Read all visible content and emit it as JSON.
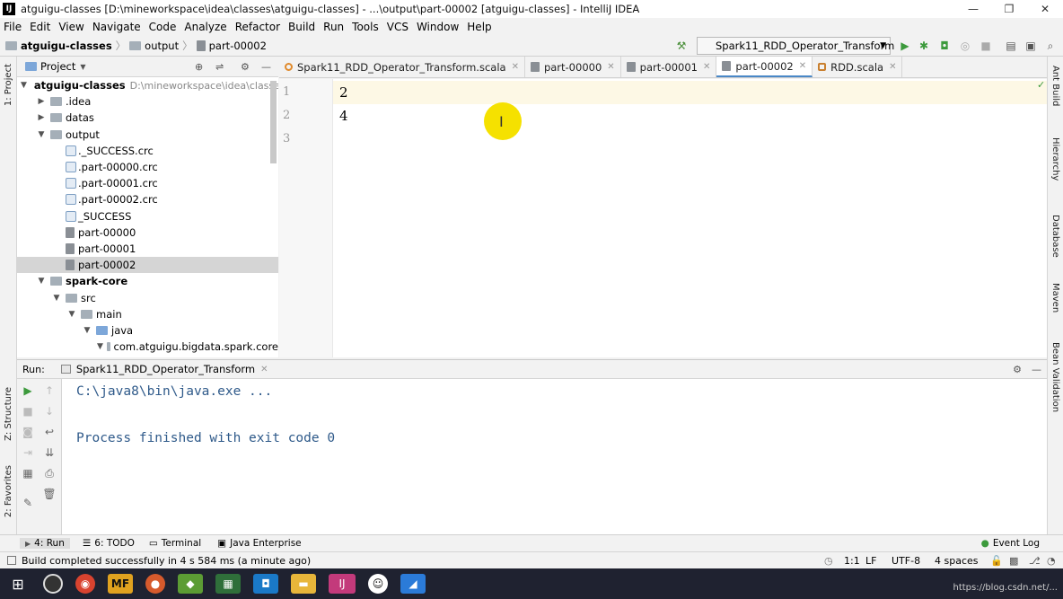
{
  "window": {
    "title": "atguigu-classes [D:\\mineworkspace\\idea\\classes\\atguigu-classes] - ...\\output\\part-00002 [atguigu-classes] - IntelliJ IDEA",
    "app_icon": "IJ"
  },
  "menu": [
    "File",
    "Edit",
    "View",
    "Navigate",
    "Code",
    "Analyze",
    "Refactor",
    "Build",
    "Run",
    "Tools",
    "VCS",
    "Window",
    "Help"
  ],
  "breadcrumb": {
    "project": "atguigu-classes",
    "folder": "output",
    "file": "part-00002"
  },
  "run_config": "Spark11_RDD_Operator_Transform",
  "project_panel": {
    "title": "Project",
    "tree": [
      {
        "label": "atguigu-classes",
        "path": "D:\\mineworkspace\\idea\\classes\\a",
        "level": 0,
        "arrow": "v",
        "type": "module",
        "bold": true
      },
      {
        "label": ".idea",
        "level": 1,
        "arrow": ">",
        "type": "folder"
      },
      {
        "label": "datas",
        "level": 1,
        "arrow": ">",
        "type": "folder"
      },
      {
        "label": "output",
        "level": 1,
        "arrow": "v",
        "type": "folder"
      },
      {
        "label": "._SUCCESS.crc",
        "level": 2,
        "type": "crc"
      },
      {
        "label": ".part-00000.crc",
        "level": 2,
        "type": "crc"
      },
      {
        "label": ".part-00001.crc",
        "level": 2,
        "type": "crc"
      },
      {
        "label": ".part-00002.crc",
        "level": 2,
        "type": "crc"
      },
      {
        "label": "_SUCCESS",
        "level": 2,
        "type": "crc"
      },
      {
        "label": "part-00000",
        "level": 2,
        "type": "file"
      },
      {
        "label": "part-00001",
        "level": 2,
        "type": "file"
      },
      {
        "label": "part-00002",
        "level": 2,
        "type": "file",
        "selected": true
      },
      {
        "label": "spark-core",
        "level": 1,
        "arrow": "v",
        "type": "module",
        "bold": true
      },
      {
        "label": "src",
        "level": 2,
        "arrow": "v",
        "type": "folder"
      },
      {
        "label": "main",
        "level": 3,
        "arrow": "v",
        "type": "folder"
      },
      {
        "label": "java",
        "level": 4,
        "arrow": "v",
        "type": "bluefolder"
      },
      {
        "label": "com.atguigu.bigdata.spark.core",
        "level": 5,
        "arrow": "v",
        "type": "folder"
      }
    ]
  },
  "tabs": [
    {
      "label": "Spark11_RDD_Operator_Transform.scala",
      "icon": "scala-object-icon"
    },
    {
      "label": "part-00000",
      "icon": "file-icon"
    },
    {
      "label": "part-00001",
      "icon": "file-icon"
    },
    {
      "label": "part-00002",
      "icon": "file-icon",
      "active": true
    },
    {
      "label": "RDD.scala",
      "icon": "scala-class-icon"
    }
  ],
  "editor": {
    "line_numbers": [
      "1",
      "2",
      "3"
    ],
    "lines": [
      "2",
      "4",
      ""
    ]
  },
  "run_panel": {
    "label": "Run:",
    "tab": "Spark11_RDD_Operator_Transform",
    "console": [
      "C:\\java8\\bin\\java.exe ...",
      "",
      "Process finished with exit code 0"
    ]
  },
  "left_strip": {
    "project": "1: Project",
    "structure": "Z: Structure",
    "favorites": "2: Favorites"
  },
  "right_strip": {
    "ant": "Ant Build",
    "hierarchy": "Hierarchy",
    "database": "Database",
    "maven": "Maven",
    "bean": "Bean Validation"
  },
  "bottom_tabs": [
    "4: Run",
    "6: TODO",
    "Terminal",
    "Java Enterprise"
  ],
  "event_log": "Event Log",
  "status": {
    "message": "Build completed successfully in 4 s 584 ms (a minute ago)",
    "position": "1:1",
    "line_sep": "LF",
    "encoding": "UTF-8",
    "indent": "4 spaces"
  },
  "watermark": "https://blog.csdn.net/..."
}
